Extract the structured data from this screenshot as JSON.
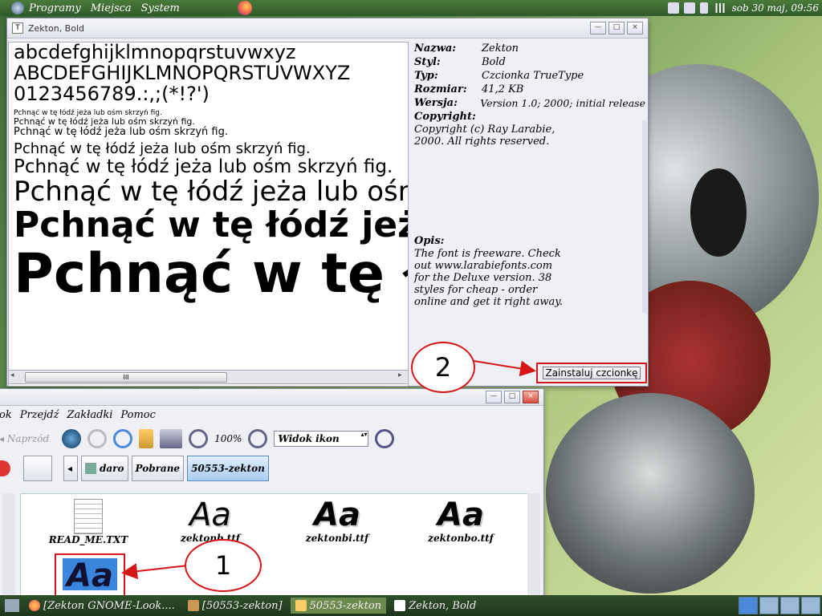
{
  "top_panel": {
    "menus": [
      "Programy",
      "Miejsca",
      "System"
    ],
    "clock": "sob 30 maj, 09:56"
  },
  "font_window": {
    "title": "Zekton, Bold",
    "preview_lines": [
      "abcdefghijklmnopqrstuvwxyz",
      "ABCDEFGHIJKLMNOPQRSTUVWXYZ",
      "0123456789.:,;(*!?')",
      "Pchnąć w tę łódź jeża lub ośm skrzyń fig.",
      "Pchnąć w tę łódź jeża lub ośm skrzyń fig.",
      "Pchnąć w tę łódź jeża lub ośm skrzyń fig.",
      "Pchnąć w tę łódź jeża lub ośm skrzyń fig.",
      "Pchnąć w tę łódź jeża lub ośm skrzyń fig.",
      "Pchnąć w tę łódź jeża lub ośm skrzyń fig.",
      "Pchnąć w tę łódź jeża lub ośm skrzyń fig.",
      "Pchnąć w tę łódź jeża lub ośm skrzyń fig."
    ],
    "info": {
      "name_label": "Nazwa:",
      "name": "Zekton",
      "style_label": "Styl:",
      "style": "Bold",
      "type_label": "Typ:",
      "type": "Czcionka TrueType",
      "size_label": "Rozmiar:",
      "size": "41,2 KB",
      "version_label": "Wersja:",
      "version": "Version 1.0; 2000; initial release",
      "copyright_label": "Copyright:",
      "copyright": "Copyright (c) Ray Larabie, 2000. All rights reserved.",
      "desc_label": "Opis:",
      "desc": "The font is freeware. Check out www.larabiefonts.com for the Deluxe version. 38 styles for cheap - order online and get it right away."
    },
    "install_button": "Zainstaluj czcionkę",
    "scroll_grip": "III"
  },
  "file_manager": {
    "menus": [
      "ok",
      "Przejdź",
      "Zakładki",
      "Pomoc"
    ],
    "forward_label": "Naprzód",
    "zoom": "100%",
    "view_mode": "Widok ikon",
    "path": [
      "daro",
      "Pobrane",
      "50553-zekton"
    ],
    "files": [
      {
        "name": "READ_ME.TXT"
      },
      {
        "name": "zektonb.ttf",
        "glyph": "Aa"
      },
      {
        "name": "zektonbi.ttf",
        "glyph": "Aa"
      },
      {
        "name": "zektonbo.ttf",
        "glyph": "Aa"
      }
    ],
    "selected_glyph": "Aa"
  },
  "callouts": {
    "one": "1",
    "two": "2"
  },
  "taskbar": {
    "items": [
      "[Zekton GNOME-Look....",
      "[50553-zekton]",
      "50553-zekton",
      "Zekton, Bold"
    ]
  }
}
